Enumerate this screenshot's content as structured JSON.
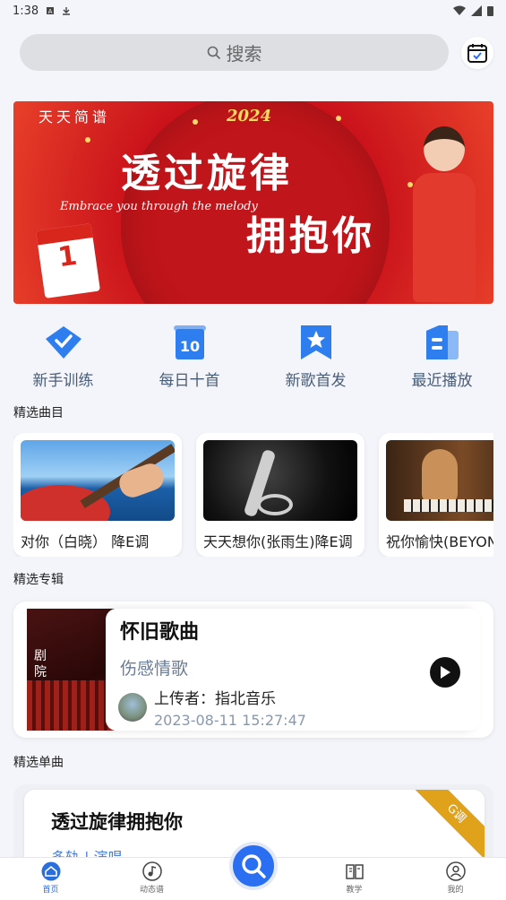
{
  "status": {
    "time": "1:38"
  },
  "search": {
    "placeholder": "搜索"
  },
  "banner": {
    "brand": "天天简谱",
    "year": "2024",
    "headline_1": "透过旋律",
    "headline_2": "拥抱你",
    "subline": "Embrace you through the melody",
    "calendar_num": "1"
  },
  "quick_entries": [
    {
      "label": "新手训练",
      "icon": "diamond-icon"
    },
    {
      "label": "每日十首",
      "icon": "daily-10-icon",
      "badge": "10"
    },
    {
      "label": "新歌首发",
      "icon": "star-bookmark-icon"
    },
    {
      "label": "最近播放",
      "icon": "recent-doc-icon"
    }
  ],
  "sections": {
    "songs": "精选曲目",
    "albums": "精选专辑",
    "singles": "精选单曲"
  },
  "songs": [
    {
      "title": "对你（白晓） 降E调"
    },
    {
      "title": "天天想你(张雨生)降E调"
    },
    {
      "title": "祝你愉快(BEYOND)"
    }
  ],
  "album": {
    "name": "怀旧歌曲",
    "category": "伤感情歌",
    "uploader": "上传者：指北音乐",
    "date": "2023-08-11 15:27:47",
    "cover_text": "剧院"
  },
  "single": {
    "title": "透过旋律拥抱你",
    "tags": "多轨 | 演唱",
    "key_badge": "G调"
  },
  "tabs": [
    {
      "label": "首页",
      "active": true
    },
    {
      "label": "动态谱"
    },
    {
      "label": ""
    },
    {
      "label": "教学"
    },
    {
      "label": "我的"
    }
  ],
  "colors": {
    "accent": "#2a6ff2",
    "banner_red": "#c8101a",
    "ribbon": "#e0a21a"
  }
}
